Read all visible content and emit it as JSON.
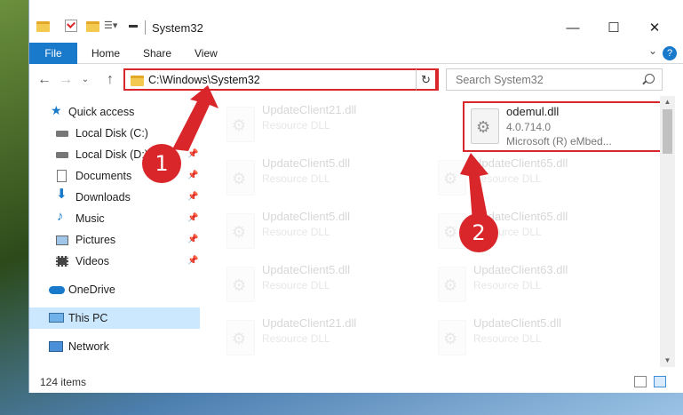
{
  "window": {
    "title": "System32",
    "controls": {
      "minimize": "—",
      "maximize": "☐",
      "close": "✕"
    }
  },
  "ribbon": {
    "tabs": [
      "File",
      "Home",
      "Share",
      "View"
    ],
    "help": "?"
  },
  "address_bar": {
    "path": "C:\\Windows\\System32",
    "refresh": "↻"
  },
  "search": {
    "placeholder": "Search System32"
  },
  "sidebar": {
    "quick_access": "Quick access",
    "items": [
      {
        "label": "Local Disk (C:)",
        "pinned": true
      },
      {
        "label": "Local Disk (D:)",
        "pinned": true
      },
      {
        "label": "Documents",
        "pinned": true
      },
      {
        "label": "Downloads",
        "pinned": true
      },
      {
        "label": "Music",
        "pinned": true
      },
      {
        "label": "Pictures",
        "pinned": true
      },
      {
        "label": "Videos",
        "pinned": true
      }
    ],
    "onedrive": "OneDrive",
    "this_pc": "This PC",
    "network": "Network",
    "pin_glyph": "📌"
  },
  "files": [
    {
      "name": "UpdateClient21.dll",
      "desc": "Resource DLL"
    },
    {
      "name": "odemul.dll",
      "version": "4.0.714.0",
      "desc": "Microsoft (R) eMbed..."
    },
    {
      "name": "UpdateClient5.dll",
      "desc": "Resource DLL"
    },
    {
      "name": "UpdateClient65.dll",
      "desc": "Resource DLL"
    },
    {
      "name": "UpdateClient5.dll",
      "desc": "Resource DLL"
    },
    {
      "name": "UpdateClient65.dll",
      "desc": "Resource DLL"
    },
    {
      "name": "UpdateClient5.dll",
      "desc": "Resource DLL"
    },
    {
      "name": "UpdateClient63.dll",
      "desc": "Resource DLL"
    },
    {
      "name": "UpdateClient21.dll",
      "desc": "Resource DLL"
    },
    {
      "name": "UpdateClient5.dll",
      "desc": "Resource DLL"
    }
  ],
  "status": {
    "item_count": "124 items"
  },
  "annotations": {
    "step1": "1",
    "step2": "2",
    "color": "#d9262a"
  }
}
